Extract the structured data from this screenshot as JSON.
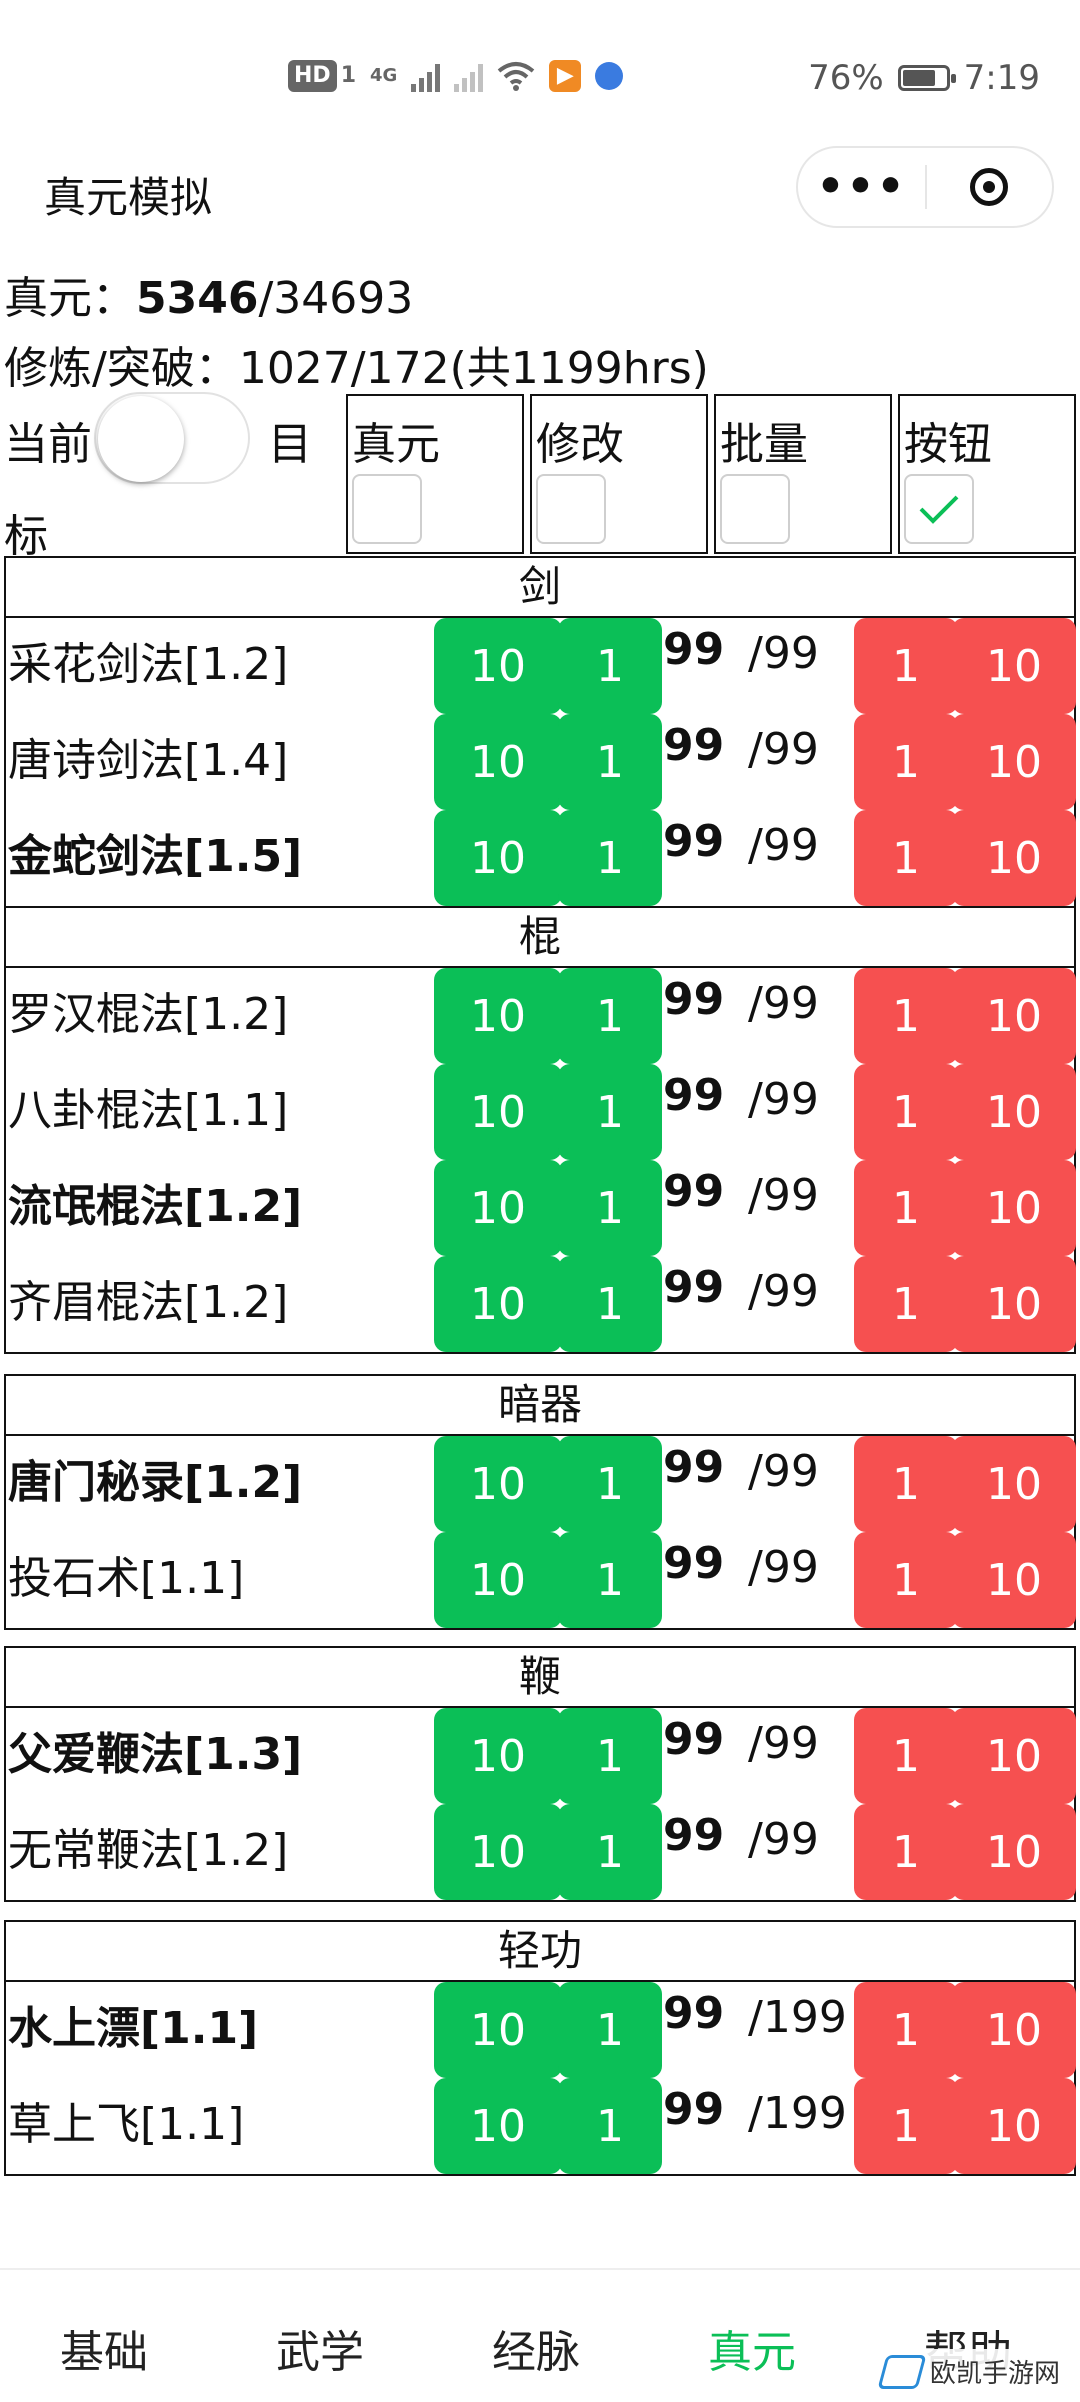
{
  "status_bar": {
    "hd": "HD",
    "sim": "1",
    "net": "4G",
    "app_badge": "▶",
    "battery": "76%",
    "battery_level": 0.76,
    "time": "7:19"
  },
  "titlebar": {
    "title": "真元模拟",
    "more": "•••"
  },
  "stats": {
    "zhenyuan_label": "真元：",
    "zhenyuan_current": "5346",
    "zhenyuan_total": "/34693",
    "train_line": "修炼/突破：1027/172(共1199hrs)"
  },
  "controls": {
    "left_label": "当前",
    "right_label": "目",
    "right_label2": "标",
    "options": [
      {
        "label": "真元",
        "checked": false
      },
      {
        "label": "修改",
        "checked": false
      },
      {
        "label": "批量",
        "checked": false
      },
      {
        "label": "按钮",
        "checked": true
      }
    ]
  },
  "buttons": {
    "plus10": "10",
    "plus1": "1",
    "minus1": "1",
    "minus10": "10"
  },
  "sections": [
    {
      "title": "剑",
      "rows": [
        {
          "name": "采花剑法[1.2]",
          "bold": false,
          "cur": "99",
          "max": "/99"
        },
        {
          "name": "唐诗剑法[1.4]",
          "bold": false,
          "cur": "99",
          "max": "/99"
        },
        {
          "name": "金蛇剑法[1.5]",
          "bold": true,
          "cur": "99",
          "max": "/99"
        }
      ]
    },
    {
      "title": "棍",
      "rows": [
        {
          "name": "罗汉棍法[1.2]",
          "bold": false,
          "cur": "99",
          "max": "/99"
        },
        {
          "name": "八卦棍法[1.1]",
          "bold": false,
          "cur": "99",
          "max": "/99"
        },
        {
          "name": "流氓棍法[1.2]",
          "bold": true,
          "cur": "99",
          "max": "/99"
        },
        {
          "name": "齐眉棍法[1.2]",
          "bold": false,
          "cur": "99",
          "max": "/99"
        }
      ]
    },
    {
      "title": "暗器",
      "rows": [
        {
          "name": "唐门秘录[1.2]",
          "bold": true,
          "cur": "99",
          "max": "/99"
        },
        {
          "name": "投石术[1.1]",
          "bold": false,
          "cur": "99",
          "max": "/99"
        }
      ]
    },
    {
      "title": "鞭",
      "rows": [
        {
          "name": "父爱鞭法[1.3]",
          "bold": true,
          "cur": "99",
          "max": "/99"
        },
        {
          "name": "无常鞭法[1.2]",
          "bold": false,
          "cur": "99",
          "max": "/99"
        }
      ]
    },
    {
      "title": "轻功",
      "rows": [
        {
          "name": "水上漂[1.1]",
          "bold": true,
          "cur": "99",
          "max": "/199"
        },
        {
          "name": "草上飞[1.1]",
          "bold": false,
          "cur": "99",
          "max": "/199"
        }
      ]
    }
  ],
  "tabs": [
    {
      "label": "基础",
      "active": false
    },
    {
      "label": "武学",
      "active": false
    },
    {
      "label": "经脉",
      "active": false
    },
    {
      "label": "真元",
      "active": true
    },
    {
      "label": "帮助",
      "active": false
    }
  ],
  "watermark": "欧凯手游网",
  "colors": {
    "green": "#0bbf57",
    "red": "#f65050",
    "active_tab": "#0bbf57"
  }
}
